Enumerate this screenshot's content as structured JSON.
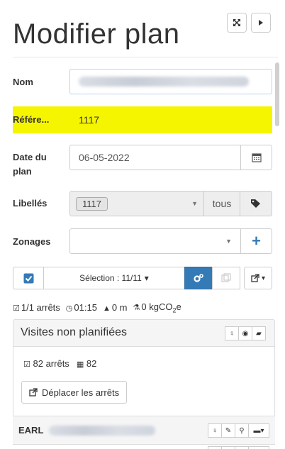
{
  "header": {
    "title": "Modifier plan",
    "expand_icon": "expand-icon",
    "next_icon": "caret-right-icon"
  },
  "form": {
    "nom_label": "Nom",
    "reference_label": "Référe...",
    "reference_value": "1117",
    "date_label": "Date du plan",
    "date_value": "06-05-2022",
    "libelles_label": "Libellés",
    "libelles_tag": "1117",
    "libelles_scope": "tous",
    "zonages_label": "Zonages",
    "add_symbol": "+"
  },
  "toolbar": {
    "selection_label": "Sélection : 11/11",
    "caret": "▾"
  },
  "stats": {
    "arrets": "1/1 arrêts",
    "duration": "01:15",
    "distance": "0 m",
    "co2": "0 kgCO",
    "co2_sub": "2",
    "co2_suffix": "e"
  },
  "unplanned": {
    "title": "Visites non planifiées",
    "arrets_count": "82 arrêts",
    "other_count": "82",
    "move_button": "Déplacer les arrêts"
  },
  "rows": [
    {
      "name": "EARL"
    }
  ],
  "colors": {
    "highlight": "#f6f500",
    "primary": "#337ab7",
    "accent_plus": "#337ab7"
  }
}
